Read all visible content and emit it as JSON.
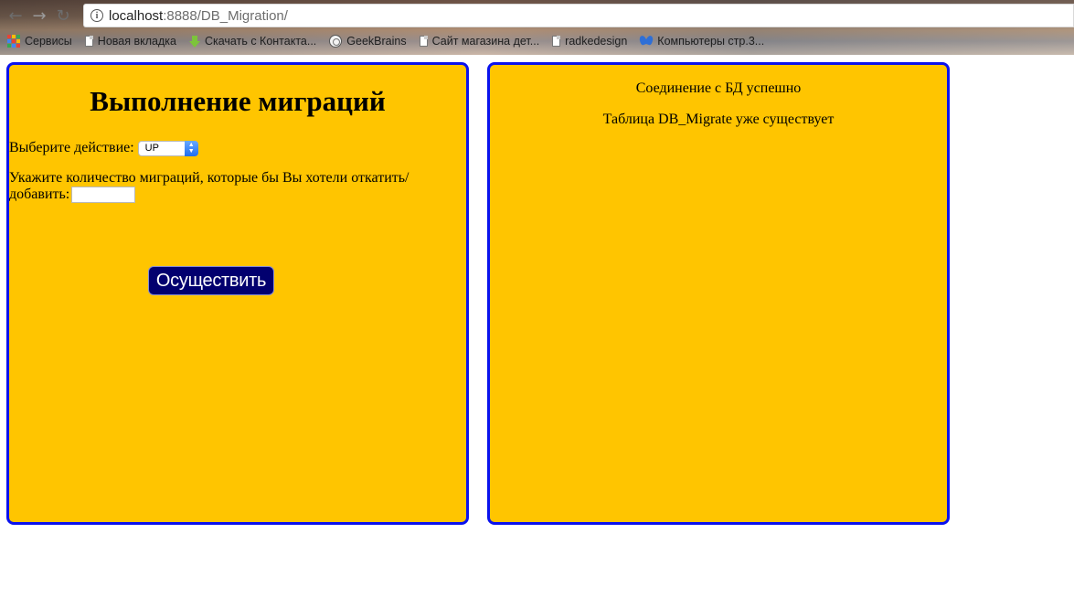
{
  "browser": {
    "nav": {
      "back_icon": "←",
      "forward_icon": "→",
      "reload_icon": "↻"
    },
    "url_host": "localhost",
    "url_path": ":8888/DB_Migration/",
    "bookmarks": [
      {
        "label": "Сервисы",
        "icon": "apps-icon"
      },
      {
        "label": "Новая вкладка",
        "icon": "doc-icon"
      },
      {
        "label": "Скачать с Контакта...",
        "icon": "download-icon"
      },
      {
        "label": "GeekBrains",
        "icon": "brain-icon"
      },
      {
        "label": "Сайт магазина дет...",
        "icon": "doc-icon"
      },
      {
        "label": "radkedesign",
        "icon": "doc-icon"
      },
      {
        "label": "Компьютеры стр.3...",
        "icon": "butterfly-icon"
      }
    ]
  },
  "left_panel": {
    "title": "Выполнение миграций",
    "action_label": "Выберите действие:",
    "action_selected": "UP",
    "count_label": "Укажите количество миграций, которые бы Вы хотели откатить/добавить:",
    "count_value": "",
    "submit_label": "Осуществить"
  },
  "right_panel": {
    "messages": [
      "Соединение с БД успешно",
      "Таблица DB_Migrate уже существует"
    ]
  },
  "colors": {
    "panel_bg": "#ffc500",
    "panel_border": "#0a12ee",
    "button_bg": "#02006f"
  }
}
